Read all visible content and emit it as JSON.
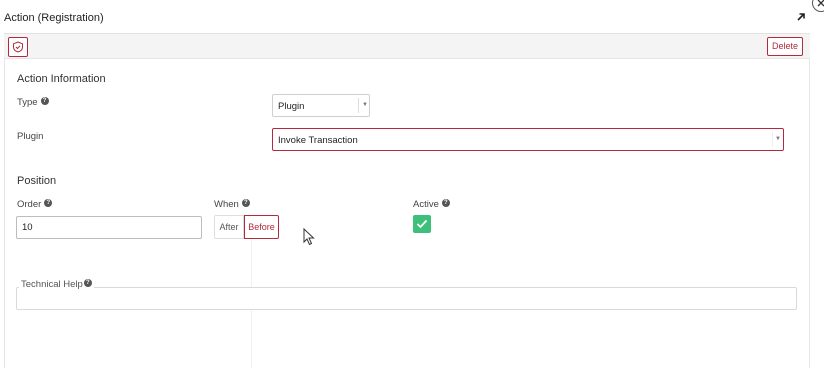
{
  "header": {
    "title": "Action (Registration)"
  },
  "toolbar": {
    "delete_label": "Delete"
  },
  "action_information": {
    "section_title": "Action Information",
    "type_label": "Type",
    "type_value": "Plugin",
    "plugin_label": "Plugin",
    "plugin_value": "Invoke Transaction"
  },
  "position": {
    "section_title": "Position",
    "order_label": "Order",
    "order_value": "10",
    "when_label": "When",
    "when_options": [
      "After",
      "Before"
    ],
    "when_selected": "Before",
    "active_label": "Active",
    "active_checked": true
  },
  "technical_help": {
    "label": "Technical Help"
  },
  "help_glyph": "?",
  "icons": {
    "header_expand": "expand-arrow-icon",
    "header_close": "close-icon",
    "toolbar_shield": "shield-icon",
    "select_arrow": "chevron-down-icon",
    "checkbox_check": "checkmark-icon",
    "help": "help-icon"
  },
  "colors": {
    "accent": "#b22a3e",
    "success": "#3ec07c",
    "toolbar_bg": "#f4f4f4"
  }
}
